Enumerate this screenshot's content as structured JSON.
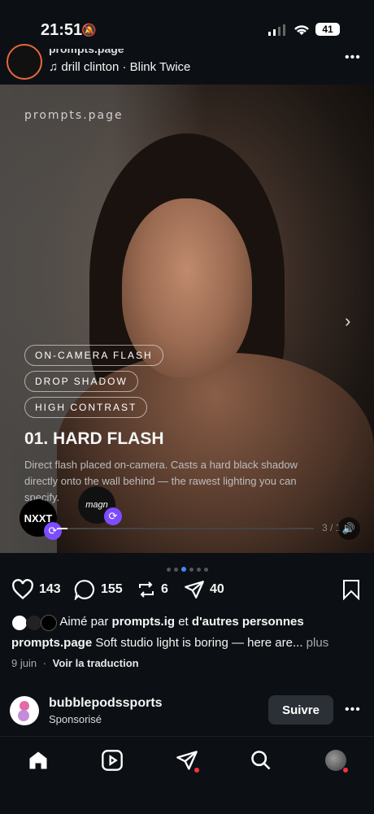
{
  "status_bar": {
    "time": "21:51",
    "battery": "41"
  },
  "post_header": {
    "username": "prompts.page",
    "music": "drill clinton · Blink Twice",
    "more": "•••"
  },
  "media": {
    "watermark": "prompts.page",
    "tags": [
      "ON-CAMERA FLASH",
      "DROP SHADOW",
      "HIGH CONTRAST"
    ],
    "title": "01. HARD FLASH",
    "description": "Direct flash placed on-camera. Casts a hard black shadow directly onto the wall behind — the rawest lighting you can specify.",
    "logos": [
      "NXXT",
      "magn"
    ],
    "progress": 0.04,
    "counter": "3 / 1"
  },
  "carousel": {
    "dot_count": 6,
    "active_index": 2
  },
  "actions": {
    "likes": "143",
    "comments": "155",
    "reposts": "6",
    "shares": "40"
  },
  "liked_by": {
    "prefix": "Aimé par",
    "user": "prompts.ig",
    "connector": "et",
    "others": "d'autres personnes"
  },
  "caption": {
    "user": "prompts.page",
    "text": "Soft studio light is boring — here are...",
    "more": "plus"
  },
  "meta": {
    "date": "9 juin",
    "separator": "·",
    "translate": "Voir la traduction"
  },
  "sponsored": {
    "username": "bubblepodssports",
    "label": "Sponsorisé",
    "follow": "Suivre",
    "more": "•••"
  },
  "nav": {
    "items": [
      "home-icon",
      "reels-icon",
      "send-icon",
      "search-icon",
      "profile-avatar"
    ]
  }
}
